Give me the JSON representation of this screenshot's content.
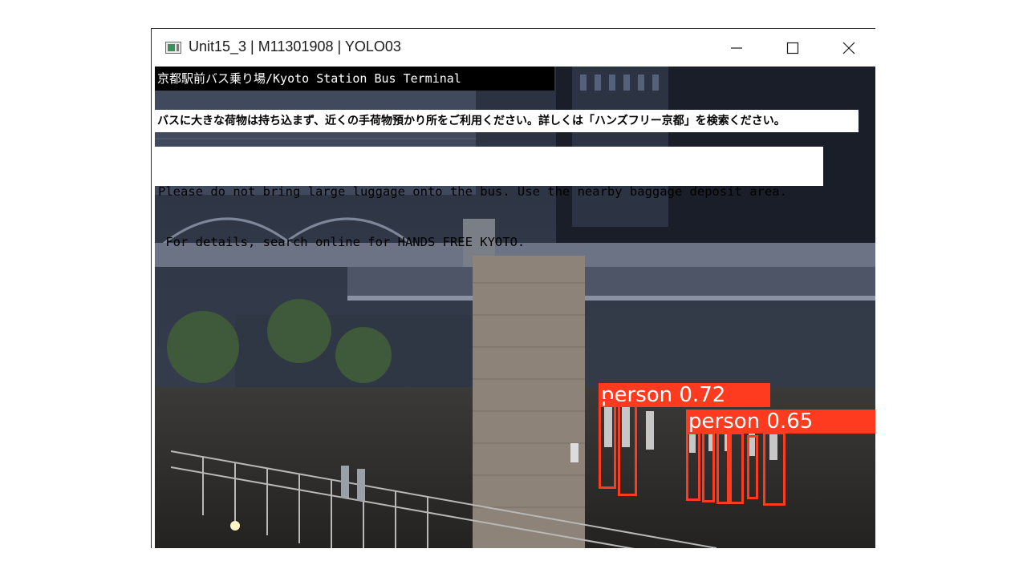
{
  "window": {
    "title": "Unit15_3 | M11301908 | YOLO03",
    "controls": [
      "minimize-icon",
      "maximize-icon",
      "close-icon"
    ]
  },
  "video": {
    "camera_title": "京都駅前バス乗り場/Kyoto Station Bus Terminal",
    "notice_jp": "バスに大きな荷物は持ち込まず、近くの手荷物預かり所をご利用ください。詳しくは「ハンズフリー京都」を検索ください。",
    "notice_en_line1": "Please do not bring large luggage onto the bus. Use the nearby baggage deposit area.",
    "notice_en_line2": " For details, search online for HANDS FREE KYOTO.",
    "detections": [
      {
        "label": "person",
        "score": "0.72"
      },
      {
        "label": "person",
        "score": "0.65"
      }
    ],
    "detection_color": "#ff3b1f"
  }
}
